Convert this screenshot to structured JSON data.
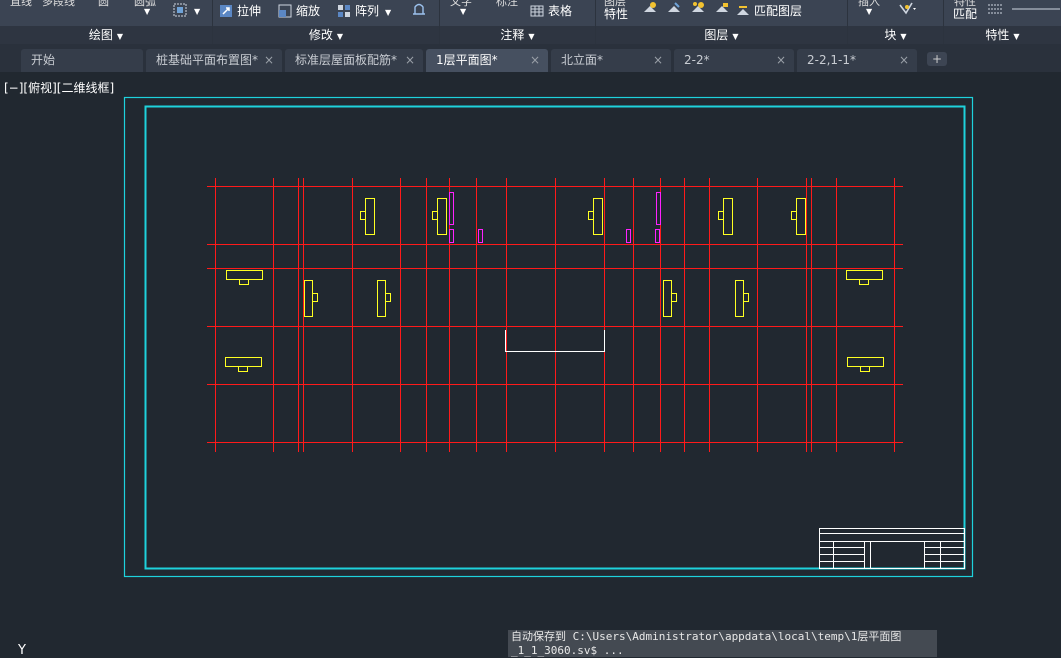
{
  "ribbon": {
    "draw_panel": {
      "title": "绘图",
      "cut_labels": [
        "直线",
        "多段线",
        "圆",
        "圆弧"
      ]
    },
    "modify_panel": {
      "title": "修改",
      "stretch": "拉伸",
      "scale": "缩放",
      "array": "阵列"
    },
    "annotate_panel": {
      "title": "注释",
      "table": "表格",
      "cut_labels": [
        "文字",
        "标注"
      ]
    },
    "layers_panel": {
      "title": "图层",
      "properties": "特性",
      "match_layer": "匹配图层",
      "cut_label": "图层"
    },
    "block_panel": {
      "title": "块",
      "cut_label": "插入"
    },
    "properties_panel": {
      "title": "特性",
      "match": "匹配",
      "cut_label": "特性"
    }
  },
  "tabs": [
    {
      "label": "开始",
      "closable": false,
      "active": false
    },
    {
      "label": "桩基础平面布置图*",
      "closable": true,
      "active": false
    },
    {
      "label": "标准层屋面板配筋*",
      "closable": true,
      "active": false
    },
    {
      "label": "1层平面图*",
      "closable": true,
      "active": true
    },
    {
      "label": "北立面*",
      "closable": true,
      "active": false
    },
    {
      "label": "2-2*",
      "closable": true,
      "active": false
    },
    {
      "label": "2-2,1-1*",
      "closable": true,
      "active": false
    }
  ],
  "new_tab": "+",
  "close_glyph": "×",
  "viewport_label": "[−][俯视][二维线框]",
  "command_line": {
    "line1": "自动保存到 C:\\Users\\Administrator\\appdata\\local\\temp\\1层平面图",
    "line2": "_1_1_3060.sv$ ..."
  },
  "ucs_label": "Y",
  "colors": {
    "background": "#212830",
    "grid": "#ff1a1a",
    "frame": "#1ed2dc",
    "symbols": "#ffff22",
    "magenta": "#ff22ff",
    "white": "#ffffff"
  }
}
